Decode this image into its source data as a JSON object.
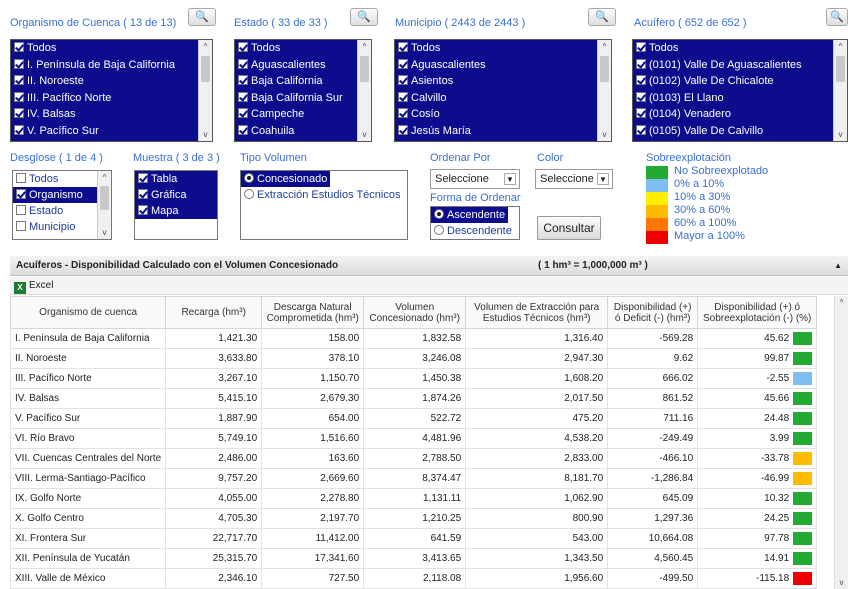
{
  "organismo": {
    "label": "Organismo de Cuenca ( 13 de  13)",
    "items": [
      "Todos",
      "I. Península de Baja California",
      "II. Noroeste",
      "III. Pacífico Norte",
      "IV. Balsas",
      "V. Pacífico Sur"
    ]
  },
  "estado": {
    "label": "Estado ( 33 de    33 )",
    "items": [
      "Todos",
      "Aguascalientes",
      "Baja California",
      "Baja California Sur",
      "Campeche",
      "Coahuila"
    ]
  },
  "municipio": {
    "label": "Municipio ( 2443 de  2443 )",
    "items": [
      "Todos",
      "Aguascalientes",
      "Asientos",
      "Calvillo",
      "Cosío",
      "Jesús María"
    ]
  },
  "acuifero": {
    "label": "Acuífero ( 652 de    652 )",
    "items": [
      "Todos",
      "(0101) Valle De Aguascalientes",
      "(0102) Valle De Chicalote",
      "(0103) El Llano",
      "(0104) Venadero",
      "(0105) Valle De Calvillo"
    ]
  },
  "search_icon": "magnifier-icon",
  "desglose": {
    "label": "Desglose ( 1 de 4 )",
    "items": [
      {
        "text": "Todos",
        "checked": false
      },
      {
        "text": "Organismo",
        "checked": true
      },
      {
        "text": "Estado",
        "checked": false
      },
      {
        "text": "Municipio",
        "checked": false
      }
    ]
  },
  "muestra": {
    "label": "Muestra ( 3 de  3 )",
    "items": [
      "Tabla",
      "Gráfica",
      "Mapa"
    ]
  },
  "tipo_volumen": {
    "label": "Tipo Volumen",
    "options": [
      {
        "text": "Concesionado",
        "selected": true
      },
      {
        "text": "Extracción Estudios Técnicos",
        "selected": false
      }
    ]
  },
  "ordenar_por": {
    "label": "Ordenar Por",
    "value": "Seleccione"
  },
  "color": {
    "label": "Color",
    "value": "Seleccione"
  },
  "forma_ordenar": {
    "label": "Forma de Ordenar",
    "options": [
      {
        "text": "Ascendente",
        "selected": true
      },
      {
        "text": "Descendente",
        "selected": false
      }
    ]
  },
  "consultar_label": "Consultar",
  "sobreexplotacion": {
    "label": "Sobreexplotación",
    "items": [
      {
        "text": "No Sobreexplotado",
        "color": "#22aa33"
      },
      {
        "text": "0% a 10%",
        "color": "#7fbef0"
      },
      {
        "text": "10% a 30%",
        "color": "#ffee00"
      },
      {
        "text": "30% a 60%",
        "color": "#ffbb00"
      },
      {
        "text": "60% a 100%",
        "color": "#ff7700"
      },
      {
        "text": "Mayor a 100%",
        "color": "#ee0000"
      }
    ]
  },
  "table": {
    "title": "Acuíferos - Disponibilidad Calculado con el Volumen Concesionado",
    "units": "( 1 hm³ = 1,000,000 m³ )",
    "excel_label": "Excel",
    "columns": [
      "Organismo de cuenca",
      "Recarga (hm³)",
      "Descarga Natural Comprometida (hm³)",
      "Volumen Concesionado (hm³)",
      "Volumen de Extracción para Estudios Técnicos (hm³)",
      "Disponibilidad (+) ó Deficit (-) (hm³)",
      "Disponibilidad (+) ó Sobreexplotación (-) (%)"
    ],
    "rows": [
      {
        "name": "I. Península de Baja California",
        "recarga": "1,421.30",
        "descarga": "158.00",
        "concesionado": "1,832.58",
        "extraccion": "1,316.40",
        "disp": "-569.28",
        "pct": "45.62",
        "color": "#22aa33"
      },
      {
        "name": "II. Noroeste",
        "recarga": "3,633.80",
        "descarga": "378.10",
        "concesionado": "3,246.08",
        "extraccion": "2,947.30",
        "disp": "9.62",
        "pct": "99.87",
        "color": "#22aa33"
      },
      {
        "name": "III. Pacífico Norte",
        "recarga": "3,267.10",
        "descarga": "1,150.70",
        "concesionado": "1,450.38",
        "extraccion": "1,608.20",
        "disp": "666.02",
        "pct": "-2.55",
        "color": "#7fbef0"
      },
      {
        "name": "IV. Balsas",
        "recarga": "5,415.10",
        "descarga": "2,679.30",
        "concesionado": "1,874.26",
        "extraccion": "2,017.50",
        "disp": "861.52",
        "pct": "45.66",
        "color": "#22aa33"
      },
      {
        "name": "V. Pacífico Sur",
        "recarga": "1,887.90",
        "descarga": "654.00",
        "concesionado": "522.72",
        "extraccion": "475.20",
        "disp": "711.16",
        "pct": "24.48",
        "color": "#22aa33"
      },
      {
        "name": "VI. Río Bravo",
        "recarga": "5,749.10",
        "descarga": "1,516.60",
        "concesionado": "4,481.96",
        "extraccion": "4,538.20",
        "disp": "-249.49",
        "pct": "3.99",
        "color": "#22aa33"
      },
      {
        "name": "VII. Cuencas Centrales del Norte",
        "recarga": "2,486.00",
        "descarga": "163.60",
        "concesionado": "2,788.50",
        "extraccion": "2,833.00",
        "disp": "-466.10",
        "pct": "-33.78",
        "color": "#ffbb00"
      },
      {
        "name": "VIII. Lerma-Santiago-Pacífico",
        "recarga": "9,757.20",
        "descarga": "2,669.60",
        "concesionado": "8,374.47",
        "extraccion": "8,181.70",
        "disp": "-1,286.84",
        "pct": "-46.99",
        "color": "#ffbb00"
      },
      {
        "name": "IX. Golfo Norte",
        "recarga": "4,055.00",
        "descarga": "2,278.80",
        "concesionado": "1,131.11",
        "extraccion": "1,062.90",
        "disp": "645.09",
        "pct": "10.32",
        "color": "#22aa33"
      },
      {
        "name": "X. Golfo Centro",
        "recarga": "4,705.30",
        "descarga": "2,197.70",
        "concesionado": "1,210.25",
        "extraccion": "800.90",
        "disp": "1,297.36",
        "pct": "24.25",
        "color": "#22aa33"
      },
      {
        "name": "XI. Frontera Sur",
        "recarga": "22,717.70",
        "descarga": "11,412.00",
        "concesionado": "641.59",
        "extraccion": "543.00",
        "disp": "10,664.08",
        "pct": "97.78",
        "color": "#22aa33"
      },
      {
        "name": "XII. Península de Yucatán",
        "recarga": "25,315.70",
        "descarga": "17,341.60",
        "concesionado": "3,413.65",
        "extraccion": "1,343.50",
        "disp": "4,560.45",
        "pct": "14.91",
        "color": "#22aa33"
      },
      {
        "name": "XIII. Valle de México",
        "recarga": "2,346.10",
        "descarga": "727.50",
        "concesionado": "2,118.08",
        "extraccion": "1,956.60",
        "disp": "-499.50",
        "pct": "-115.18",
        "color": "#ee0000"
      }
    ]
  }
}
